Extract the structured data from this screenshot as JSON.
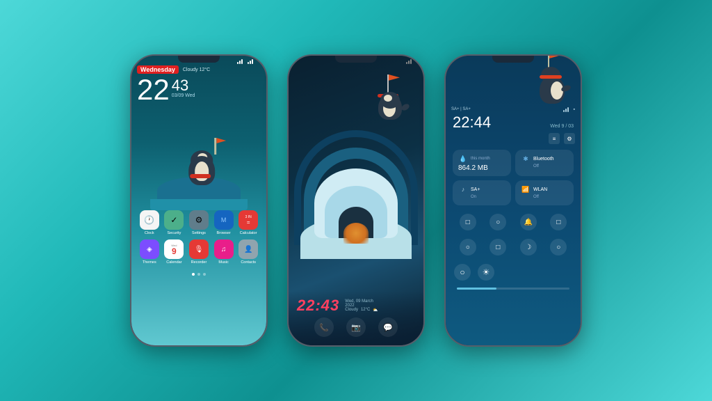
{
  "background": "#2ac0c0",
  "phone1": {
    "status": "●●●▲▲▲",
    "day": "Wednesday",
    "weather": "Cloudy 12°C",
    "hour": "22",
    "minutes": "43",
    "datestr": "03/09 Wed",
    "apps_row1": [
      {
        "label": "Clock",
        "color": "#f5f5f5"
      },
      {
        "label": "Security",
        "color": "#4caf8a"
      },
      {
        "label": "Settings",
        "color": "#607d8b"
      },
      {
        "label": "Browser",
        "color": "#1565c0"
      },
      {
        "label": "Calculator",
        "color": "#e53935"
      }
    ],
    "apps_row2": [
      {
        "label": "Themes",
        "color": "#7c4dff"
      },
      {
        "label": "Calendar",
        "color": "#ffffff"
      },
      {
        "label": "Recorder",
        "color": "#e53935"
      },
      {
        "label": "Music",
        "color": "#e91e8a"
      },
      {
        "label": "Contacts",
        "color": "#90a4ae"
      }
    ]
  },
  "phone2": {
    "time": "22:43",
    "date": "Wed, 09 March",
    "year": "2022",
    "weather_text": "Cloudy",
    "temp": "12°C",
    "nav": [
      "📞",
      "📷",
      "💬"
    ]
  },
  "phone3": {
    "sa_label": "SA+ | SA+",
    "time": "22:44",
    "date_label": "Wed 9 / 03",
    "tiles": [
      {
        "icon": "💧",
        "label": "this month",
        "value": "864.2 MB"
      },
      {
        "icon": "✱",
        "label": "Bluetooth",
        "value": "Off"
      },
      {
        "icon": "♪",
        "label": "SA+",
        "subvalue": "On"
      },
      {
        "icon": "📶",
        "label": "WLAN",
        "value": "Off"
      }
    ],
    "icon_row1": [
      "□",
      "○",
      "🔔",
      "□"
    ],
    "icon_row2": [
      "○",
      "□",
      "☽",
      "○"
    ],
    "icon_row3": [
      "○",
      "☀"
    ]
  }
}
